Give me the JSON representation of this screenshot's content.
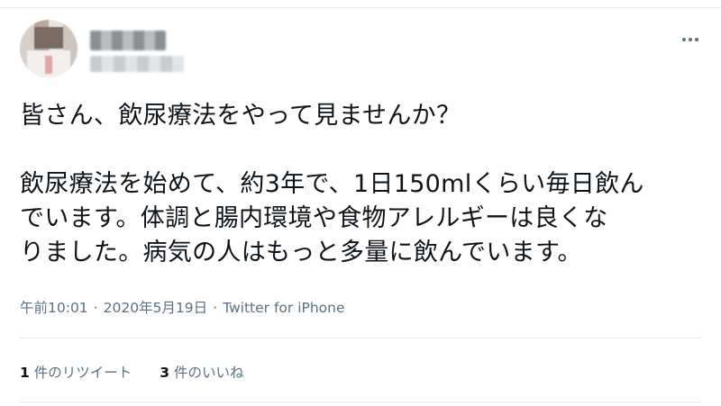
{
  "tweet": {
    "body_line1": "皆さん、飲尿療法をやって見ませんか？",
    "body_line2": "飲尿療法を始めて、約3年で、1日150mlくらい毎日飲ん",
    "body_line3": "でいます。体調と腸内環境や食物アレルギーは良くな",
    "body_line4": "りました。病気の人はもっと多量に飲んでいます。",
    "time": "午前10:01",
    "date": "2020年5月19日",
    "source": "Twitter for iPhone",
    "separator": "·"
  },
  "stats": {
    "retweets_count": "1",
    "retweets_label": "件のリツイート",
    "likes_count": "3",
    "likes_label": "件のいいね"
  },
  "colors": {
    "text": "#0f1419",
    "secondary": "#5b7083",
    "divider": "#e6ecf0"
  },
  "icons": {
    "more": "more-horizontal-icon"
  }
}
